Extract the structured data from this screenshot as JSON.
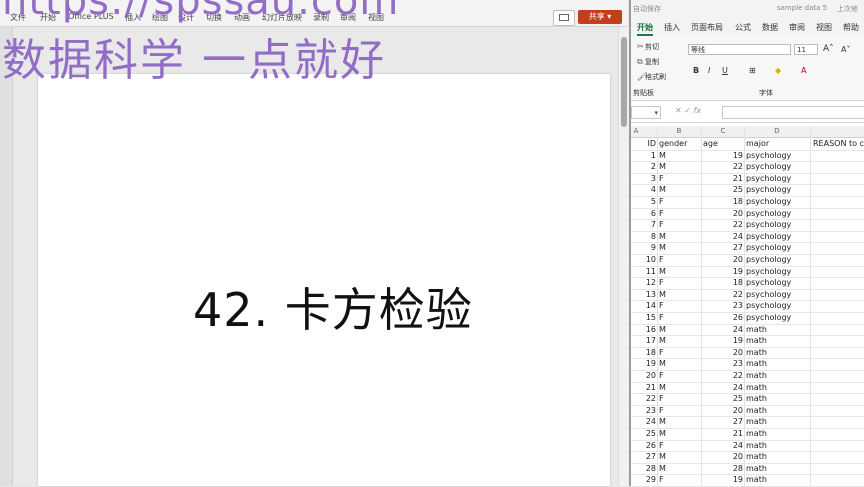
{
  "watermark": {
    "url": "https://spssau.com",
    "slogan": "数据科学 一点就好"
  },
  "ppt": {
    "tabs": [
      "文件",
      "开始",
      "Office PLUS",
      "插入",
      "绘图",
      "设计",
      "切换",
      "动画",
      "幻灯片放映",
      "录制",
      "审阅",
      "视图"
    ],
    "comment_icon": "comment-icon",
    "share_label": "共享",
    "slide_title": "42. 卡方检验"
  },
  "excel": {
    "title_bar": [
      "自动保存",
      "sample data 5",
      "上次修"
    ],
    "tabs": [
      "开始",
      "插入",
      "页面布局",
      "公式",
      "数据",
      "审阅",
      "视图",
      "帮助"
    ],
    "clipboard": {
      "cut": "剪切",
      "copy": "复制",
      "format_painter": "格式刷",
      "group": "剪贴板"
    },
    "font": {
      "name": "等线",
      "size": "11",
      "group": "字体",
      "bold": "B",
      "italic": "I",
      "underline": "U"
    },
    "formula_bar": {
      "fx": "fx",
      "value": ""
    },
    "columns": [
      "A",
      "B",
      "C",
      "D"
    ],
    "headers": {
      "id": "ID",
      "gender": "gender",
      "age": "age",
      "major": "major",
      "reason": "REASON to cl"
    },
    "rows": [
      {
        "id": "1",
        "gender": "M",
        "age": "19",
        "major": "psychology"
      },
      {
        "id": "2",
        "gender": "M",
        "age": "22",
        "major": "psychology"
      },
      {
        "id": "3",
        "gender": "F",
        "age": "21",
        "major": "psychology"
      },
      {
        "id": "4",
        "gender": "M",
        "age": "25",
        "major": "psychology"
      },
      {
        "id": "5",
        "gender": "F",
        "age": "18",
        "major": "psychology"
      },
      {
        "id": "6",
        "gender": "F",
        "age": "20",
        "major": "psychology"
      },
      {
        "id": "7",
        "gender": "F",
        "age": "22",
        "major": "psychology"
      },
      {
        "id": "8",
        "gender": "M",
        "age": "24",
        "major": "psychology"
      },
      {
        "id": "9",
        "gender": "M",
        "age": "27",
        "major": "psychology"
      },
      {
        "id": "10",
        "gender": "F",
        "age": "20",
        "major": "psychology"
      },
      {
        "id": "11",
        "gender": "M",
        "age": "19",
        "major": "psychology"
      },
      {
        "id": "12",
        "gender": "F",
        "age": "18",
        "major": "psychology"
      },
      {
        "id": "13",
        "gender": "M",
        "age": "22",
        "major": "psychology"
      },
      {
        "id": "14",
        "gender": "F",
        "age": "23",
        "major": "psychology"
      },
      {
        "id": "15",
        "gender": "F",
        "age": "26",
        "major": "psychology"
      },
      {
        "id": "16",
        "gender": "M",
        "age": "24",
        "major": "math"
      },
      {
        "id": "17",
        "gender": "M",
        "age": "19",
        "major": "math"
      },
      {
        "id": "18",
        "gender": "F",
        "age": "20",
        "major": "math"
      },
      {
        "id": "19",
        "gender": "M",
        "age": "23",
        "major": "math"
      },
      {
        "id": "20",
        "gender": "F",
        "age": "22",
        "major": "math"
      },
      {
        "id": "21",
        "gender": "M",
        "age": "24",
        "major": "math"
      },
      {
        "id": "22",
        "gender": "F",
        "age": "25",
        "major": "math"
      },
      {
        "id": "23",
        "gender": "F",
        "age": "20",
        "major": "math"
      },
      {
        "id": "24",
        "gender": "M",
        "age": "27",
        "major": "math"
      },
      {
        "id": "25",
        "gender": "M",
        "age": "21",
        "major": "math"
      },
      {
        "id": "26",
        "gender": "F",
        "age": "24",
        "major": "math"
      },
      {
        "id": "27",
        "gender": "M",
        "age": "20",
        "major": "math"
      },
      {
        "id": "28",
        "gender": "M",
        "age": "28",
        "major": "math"
      },
      {
        "id": "29",
        "gender": "F",
        "age": "19",
        "major": "math"
      }
    ]
  }
}
